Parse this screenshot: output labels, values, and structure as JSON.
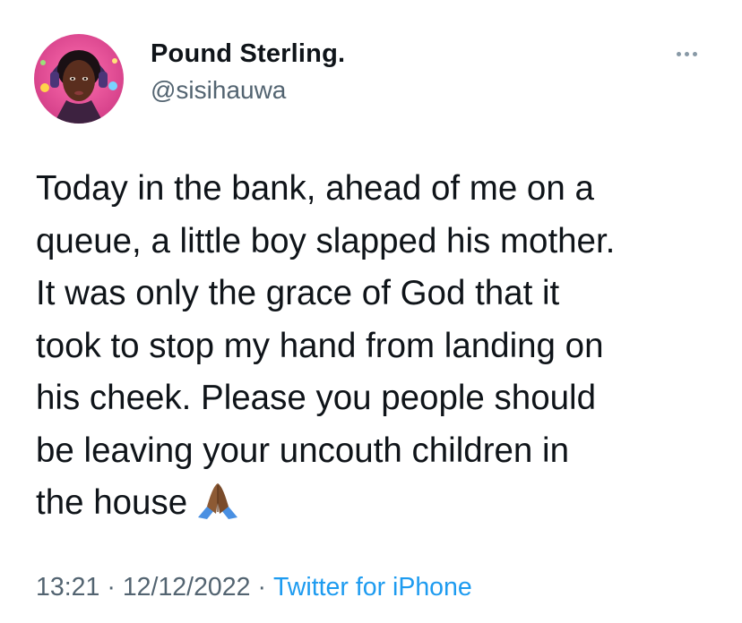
{
  "author": {
    "display_name": "Pound Sterling.",
    "handle": "@sisihauwa"
  },
  "more_icon": "more-horizontal-icon",
  "tweet": {
    "lines": [
      "Today in the bank, ahead of me on a",
      "queue, a little boy slapped his mother.",
      "It was only the grace of God that it",
      "took to stop my hand from landing on",
      "his cheek. Please you people should",
      "be leaving your uncouth children in",
      "the house"
    ],
    "emoji": "folded-hands-emoji"
  },
  "meta": {
    "time": "13:21",
    "separator": "·",
    "date": "12/12/2022",
    "source": "Twitter for iPhone"
  },
  "colors": {
    "text": "#0f1419",
    "secondary": "#536471",
    "link": "#1d9bf0"
  }
}
